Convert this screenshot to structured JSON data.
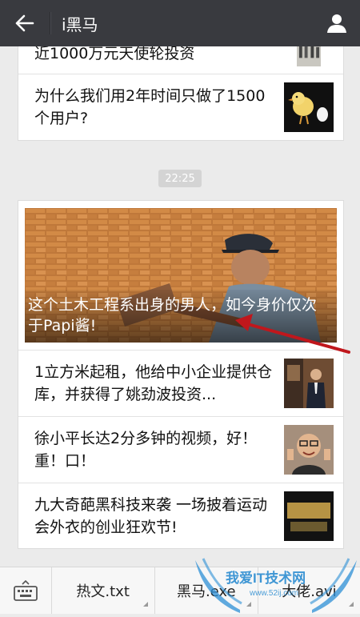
{
  "header": {
    "title": "i黑马"
  },
  "feed": {
    "card1": {
      "items": [
        {
          "title": "近1000万元天使轮投资"
        },
        {
          "title": "为什么我们用2年时间只做了1500个用户?"
        }
      ]
    },
    "timestamp": "22:25",
    "card2": {
      "hero_title": "这个土木工程系出身的男人，如今身价仅次于Papi酱!",
      "items": [
        {
          "title": "1立方米起租，他给中小企业提供仓库，并获得了姚劲波投资..."
        },
        {
          "title": "徐小平长达2分多钟的视频，好！重！口！"
        },
        {
          "title": "九大奇葩黑科技来袭 一场披着运动会外衣的创业狂欢节!"
        }
      ]
    }
  },
  "bottom_menu": {
    "items": [
      {
        "label": "热文.txt"
      },
      {
        "label": "黑马.exe"
      },
      {
        "label": "大佬.avi"
      }
    ]
  },
  "watermark": {
    "text": "我爱IT技术网",
    "sub": "www.52ij.com"
  },
  "colors": {
    "topbar": "#393a3f",
    "background": "#ebebeb",
    "annotation_arrow": "#c0171c"
  }
}
